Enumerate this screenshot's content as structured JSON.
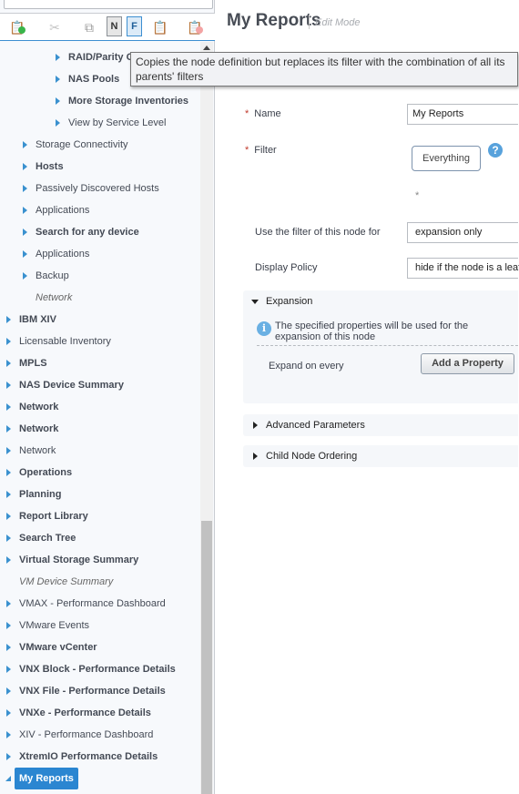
{
  "toolbar": {
    "n_label": "N",
    "f_label": "F",
    "tooltip": "Copies the node definition but replaces its filter with the combination of all its parents' filters"
  },
  "tree": {
    "items": [
      {
        "label": "RAID/Parity Groups",
        "level": 2,
        "style": "b",
        "arrow": true
      },
      {
        "label": "NAS Pools",
        "level": 2,
        "style": "b",
        "arrow": true
      },
      {
        "label": "More Storage Inventories",
        "level": 2,
        "style": "b",
        "arrow": true
      },
      {
        "label": "View by Service Level",
        "level": 2,
        "style": "",
        "arrow": true
      },
      {
        "label": "Storage Connectivity",
        "level": 1,
        "style": "",
        "arrow": true
      },
      {
        "label": "Hosts",
        "level": 1,
        "style": "b",
        "arrow": true
      },
      {
        "label": "Passively Discovered Hosts",
        "level": 1,
        "style": "",
        "arrow": true
      },
      {
        "label": "Applications",
        "level": 1,
        "style": "",
        "arrow": true
      },
      {
        "label": "Search for any device",
        "level": 1,
        "style": "b",
        "arrow": true
      },
      {
        "label": "Applications",
        "level": 1,
        "style": "",
        "arrow": true
      },
      {
        "label": "Backup",
        "level": 1,
        "style": "",
        "arrow": true
      },
      {
        "label": "Network",
        "level": 1,
        "style": "it",
        "arrow": false
      },
      {
        "label": "IBM XIV",
        "level": 0,
        "style": "b",
        "arrow": true
      },
      {
        "label": "Licensable Inventory",
        "level": 0,
        "style": "",
        "arrow": true
      },
      {
        "label": "MPLS",
        "level": 0,
        "style": "b",
        "arrow": true
      },
      {
        "label": "NAS Device Summary",
        "level": 0,
        "style": "b",
        "arrow": true
      },
      {
        "label": "Network",
        "level": 0,
        "style": "b",
        "arrow": true
      },
      {
        "label": "Network",
        "level": 0,
        "style": "b",
        "arrow": true
      },
      {
        "label": "Network",
        "level": 0,
        "style": "",
        "arrow": true
      },
      {
        "label": "Operations",
        "level": 0,
        "style": "b",
        "arrow": true
      },
      {
        "label": "Planning",
        "level": 0,
        "style": "b",
        "arrow": true
      },
      {
        "label": "Report Library",
        "level": 0,
        "style": "b",
        "arrow": true
      },
      {
        "label": "Search Tree",
        "level": 0,
        "style": "b",
        "arrow": true
      },
      {
        "label": "Virtual Storage Summary",
        "level": 0,
        "style": "b",
        "arrow": true
      },
      {
        "label": "VM Device Summary",
        "level": 0,
        "style": "it",
        "arrow": false
      },
      {
        "label": "VMAX - Performance Dashboard",
        "level": 0,
        "style": "",
        "arrow": true
      },
      {
        "label": "VMware Events",
        "level": 0,
        "style": "",
        "arrow": true
      },
      {
        "label": "VMware vCenter",
        "level": 0,
        "style": "b",
        "arrow": true
      },
      {
        "label": "VNX Block - Performance Details",
        "level": 0,
        "style": "b",
        "arrow": true
      },
      {
        "label": "VNX File - Performance Details",
        "level": 0,
        "style": "b",
        "arrow": true
      },
      {
        "label": "VNXe - Performance Details",
        "level": 0,
        "style": "b",
        "arrow": true
      },
      {
        "label": "XIV - Performance Dashboard",
        "level": 0,
        "style": "",
        "arrow": true
      },
      {
        "label": "XtremIO Performance Details",
        "level": 0,
        "style": "b",
        "arrow": true
      }
    ],
    "selected": "My Reports"
  },
  "header": {
    "title": "My Reports",
    "mode": "Edit Mode"
  },
  "form": {
    "name_label": "Name",
    "name_value": "My Reports",
    "filter_label": "Filter",
    "filter_button": "Everything",
    "filter_asterisk": "*",
    "required_mark": "*",
    "use_filter_label": "Use the filter of this node for",
    "use_filter_value": "expansion only",
    "display_policy_label": "Display Policy",
    "display_policy_value": "hide if the node is a leaf"
  },
  "expansion": {
    "title": "Expansion",
    "info": "The specified properties will be used for the expansion of this node",
    "expand_label": "Expand on every",
    "add_button": "Add a Property"
  },
  "advanced": {
    "title": "Advanced Parameters"
  },
  "ordering": {
    "title": "Child Node Ordering"
  },
  "colors": {
    "accent": "#2b86d1",
    "arrow": "#3a91cf"
  }
}
